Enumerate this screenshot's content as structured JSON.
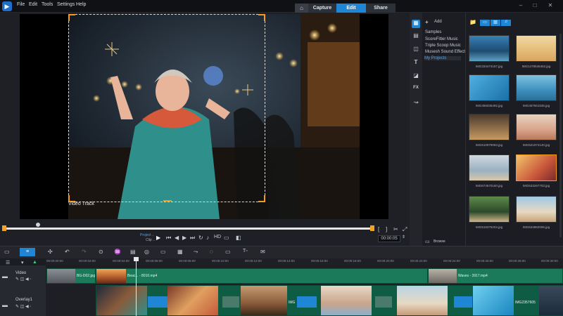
{
  "menu": [
    "File",
    "Edit",
    "Tools",
    "Settings",
    "Help"
  ],
  "tabs": {
    "capture": "Capture",
    "edit": "Edit",
    "share": "Share"
  },
  "preview": {
    "track_label": "Video Track",
    "project_label": "Project→",
    "clip_label": "Clip→",
    "hd_label": "HD",
    "timecode": "00:00:05"
  },
  "library": {
    "add_label": "Add",
    "nav": [
      "Samples",
      "ScoreFitter Music",
      "Triple Scoop Music",
      "Musesh Sound Effect",
      "My Projects"
    ],
    "browse_label": "Browse",
    "thumbs": [
      {
        "label": "IMG334474157.jpg"
      },
      {
        "label": "IMG1478546462.jpg"
      },
      {
        "label": "IMG456035492.jpg"
      },
      {
        "label": "IMG467661536.jpg"
      },
      {
        "label": "IMG610979063.jpg"
      },
      {
        "label": "IMG521974140.jpg"
      },
      {
        "label": "IMG674670160.jpg"
      },
      {
        "label": "IMG633267703.jpg"
      },
      {
        "label": "IMG518376204.jpg"
      },
      {
        "label": "IMG634862006.jpg"
      }
    ]
  },
  "timeline": {
    "ruler": [
      "00:00:00:00",
      "00:00:02:00",
      "00:00:04:00",
      "00:00:06:00",
      "00:00:08:00",
      "00:00:10:00",
      "00:00:12:00",
      "00:00:14:00",
      "00:00:16:00",
      "00:00:18:00",
      "00:00:20:00",
      "00:00:22:00",
      "00:00:24:00",
      "00:00:26:00",
      "00:00:28:00",
      "00:00:30:00"
    ],
    "video_track": "Video",
    "overlay_track": "Overlay1",
    "clips": {
      "bg": "BG-D02.jpg",
      "beach": "Beac... - 8010.mp4",
      "waves": "Waves - 3917.mp4",
      "img1": "IMG",
      "img2": "IMG2357605"
    }
  },
  "colors": {
    "accent": "#1f86d6",
    "clip": "#1b7a5a",
    "crop": "#f29b1e"
  }
}
